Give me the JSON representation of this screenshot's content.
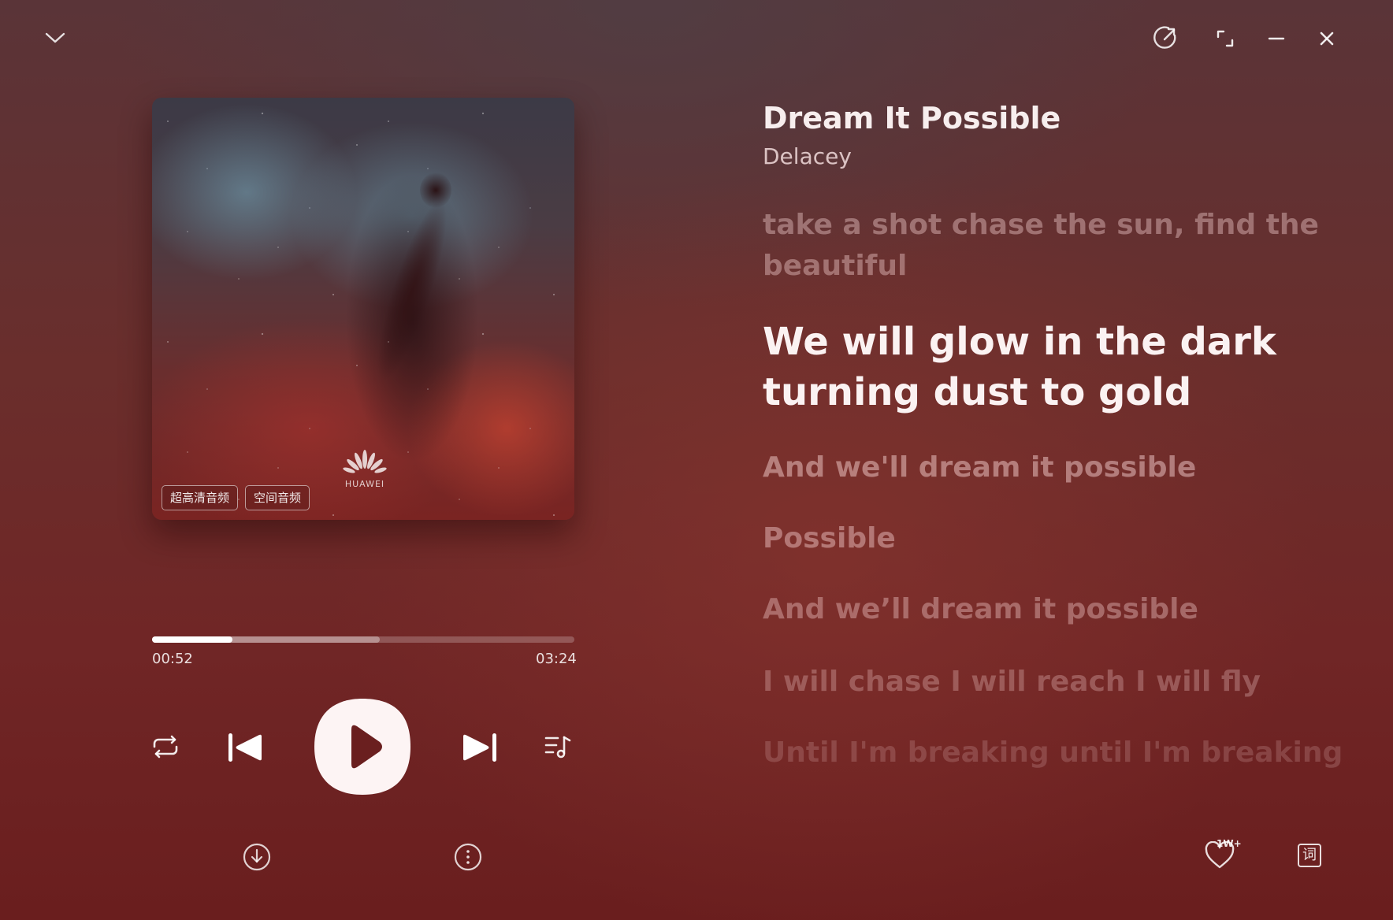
{
  "window": {
    "collapse_icon": "chevron-down-icon",
    "share_icon": "share-icon",
    "fullscreen_icon": "fullscreen-icon",
    "minimize_icon": "minimize-icon",
    "close_icon": "close-icon"
  },
  "album": {
    "logo_text": "HUAWEI",
    "badges": [
      "超高清音频",
      "空间音频"
    ]
  },
  "player": {
    "elapsed": "00:52",
    "duration": "03:24",
    "played_fraction": 0.19,
    "buffered_fraction": 0.54,
    "controls": {
      "repeat_icon": "repeat-icon",
      "previous_icon": "previous-icon",
      "play_icon": "play-icon",
      "next_icon": "next-icon",
      "playlist_icon": "playlist-icon"
    },
    "download_icon": "download-icon",
    "more_icon": "more-icon"
  },
  "song": {
    "title": "Dream It Possible",
    "artist": "Delacey"
  },
  "lyrics": [
    {
      "lines": [
        "take a shot chase the sun, find the",
        "beautiful"
      ],
      "state": "past"
    },
    {
      "lines": [
        "We will glow in the dark",
        "turning dust to gold"
      ],
      "state": "current"
    },
    {
      "lines": [
        "And we'll dream it possible"
      ],
      "state": "upcoming"
    },
    {
      "lines": [
        "Possible"
      ],
      "state": "upcoming"
    },
    {
      "lines": [
        "And we’ll dream it possible"
      ],
      "state": "upcoming"
    },
    {
      "lines": [
        "I will chase I will reach I will fly"
      ],
      "state": "upcoming"
    },
    {
      "lines": [
        "Until I'm breaking until I'm breaking"
      ],
      "state": "upcoming"
    }
  ],
  "footer": {
    "like_icon": "heart-icon",
    "like_count": "1W+",
    "lyrics_toggle_icon": "lyrics-icon",
    "lyrics_toggle_glyph": "词"
  },
  "colors": {
    "accent": "#ffffff",
    "background_top": "#5a3438",
    "background_bottom": "#6a1e1e",
    "play_button": "#fdf4f4"
  }
}
